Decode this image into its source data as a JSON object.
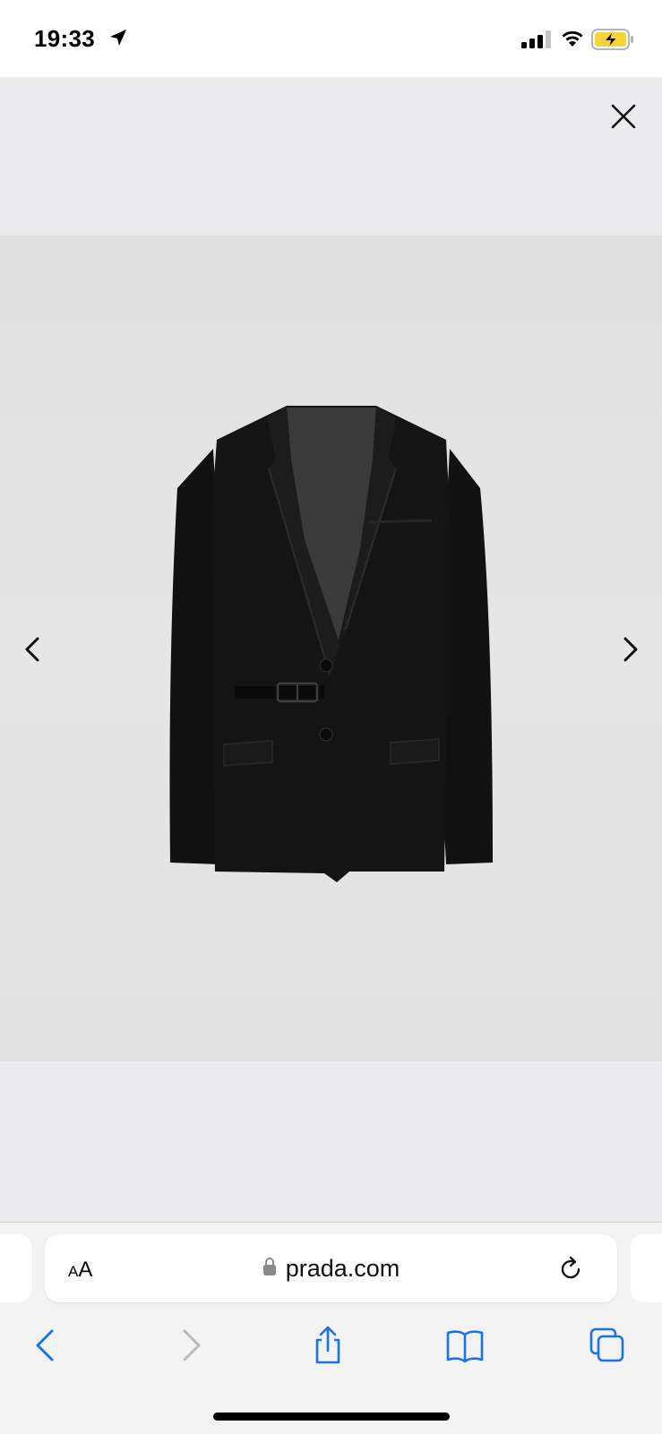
{
  "status_bar": {
    "time": "19:33",
    "icons": [
      "location-arrow-icon",
      "cellular-signal-icon",
      "wifi-icon",
      "battery-charging-icon"
    ],
    "battery_color": "#f5d33a"
  },
  "viewer": {
    "close_icon": "close-icon",
    "prev_icon": "chevron-left-icon",
    "next_icon": "chevron-right-icon",
    "product_image": "black single-breasted blazer with side buckle strap"
  },
  "browser": {
    "text_size_label_small": "A",
    "text_size_label_large": "A",
    "url": "prada.com",
    "lock_icon": "lock-icon",
    "reload_icon": "reload-icon",
    "toolbar_icons": [
      "back-icon",
      "forward-icon",
      "share-icon",
      "bookmarks-icon",
      "tabs-icon"
    ],
    "accent_color": "#1a73e8"
  }
}
